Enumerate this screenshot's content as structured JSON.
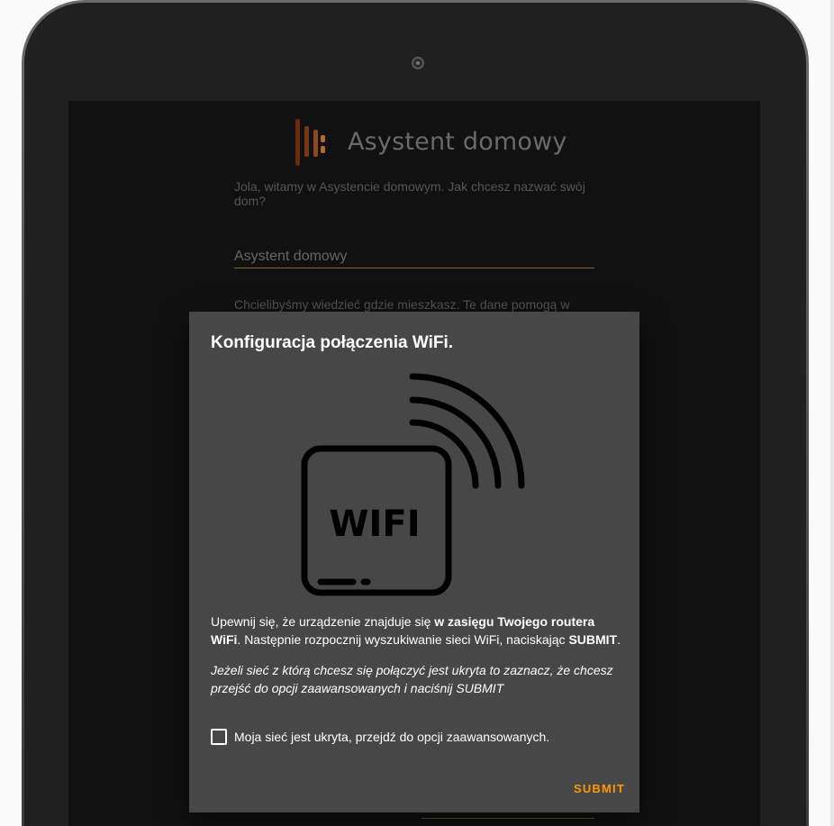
{
  "app": {
    "title": "Asystent domowy",
    "welcome_text": "Jola, witamy w Asystencie domowym. Jak chcesz nazwać swój dom?",
    "home_name_value": "Asystent domowy",
    "location_text": "Chcielibyśmy wiedzieć gdzie mieszkasz. Te dane pomogą w",
    "logo_icon": "home-assistant-logo"
  },
  "dialog": {
    "title": "Konfiguracja połączenia WiFi.",
    "illustration_icon": "wifi-router-icon",
    "illustration_label": "WIFI",
    "instructions": {
      "part1": "Upewnij się, że urządzenie znajduje się ",
      "bold1": "w zasięgu Twojego routera WiFi",
      "part2": ". Następnie rozpocznij wyszukiwanie sieci WiFi, naciskając ",
      "bold2": "SUBMIT",
      "part3": "."
    },
    "hint": "Jeżeli sieć z którą chcesz się połączyć jest ukryta to zaznacz, że chcesz przejść do opcji zaawansowanych i naciśnij SUBMIT",
    "checkbox_label": "Moja sieć jest ukryta, przejdź do opcji zaawansowanych.",
    "checkbox_checked": false,
    "submit_label": "SUBMIT"
  },
  "colors": {
    "accent": "#ff9800",
    "dialog_bg": "#474747",
    "screen_bg": "#111111"
  }
}
